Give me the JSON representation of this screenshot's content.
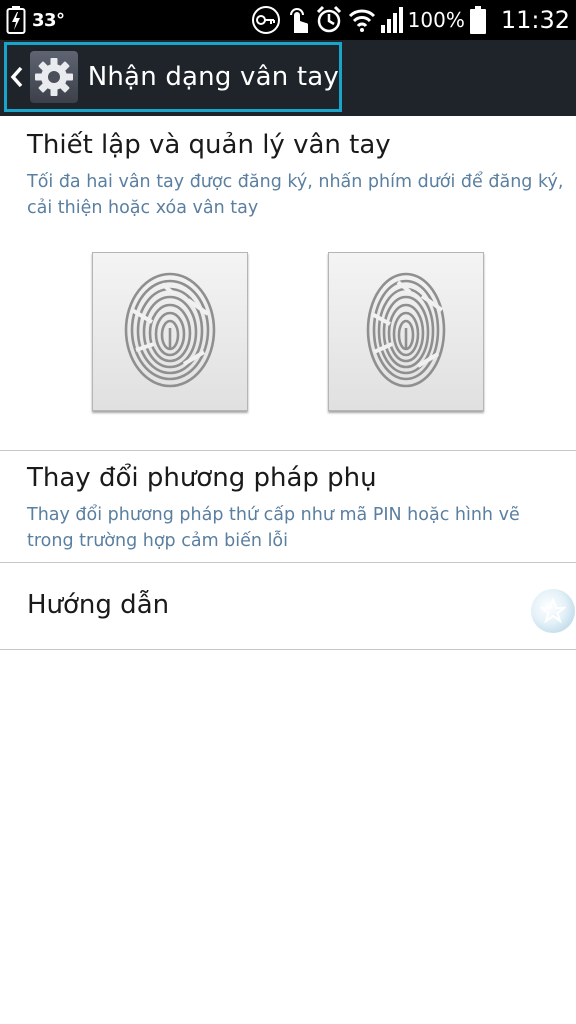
{
  "status_bar": {
    "temperature": "33°",
    "battery_percent": "100%",
    "time": "11:32",
    "icons": [
      "battery-charging-icon",
      "key-icon",
      "touch-icon",
      "alarm-icon",
      "wifi-icon",
      "signal-icon",
      "battery-icon"
    ]
  },
  "action_bar": {
    "title": "Nhận dạng vân tay",
    "icons": [
      "back-chevron-icon",
      "settings-gear-icon"
    ]
  },
  "sections": {
    "setup": {
      "title": "Thiết lập và quản lý vân tay",
      "subtitle": "Tối đa hai vân tay được đăng ký, nhấn phím dưới để đăng ký, cải thiện hoặc xóa vân tay",
      "fingerprint_slots": [
        "fingerprint-icon",
        "fingerprint-icon"
      ]
    },
    "backup": {
      "title": "Thay đổi phương pháp phụ",
      "subtitle": "Thay đổi phương pháp thứ cấp như mã PIN hoặc hình vẽ trong trường hợp cảm biến lỗi"
    },
    "guide": {
      "title": "Hướng dẫn",
      "icon": "star-orb-icon"
    }
  },
  "colors": {
    "status_bar": "#000000",
    "action_bar": "#1f242b",
    "focus_highlight": "#19a4c9",
    "subtitle": "#5a7fa0",
    "divider": "#c8c8c8"
  }
}
